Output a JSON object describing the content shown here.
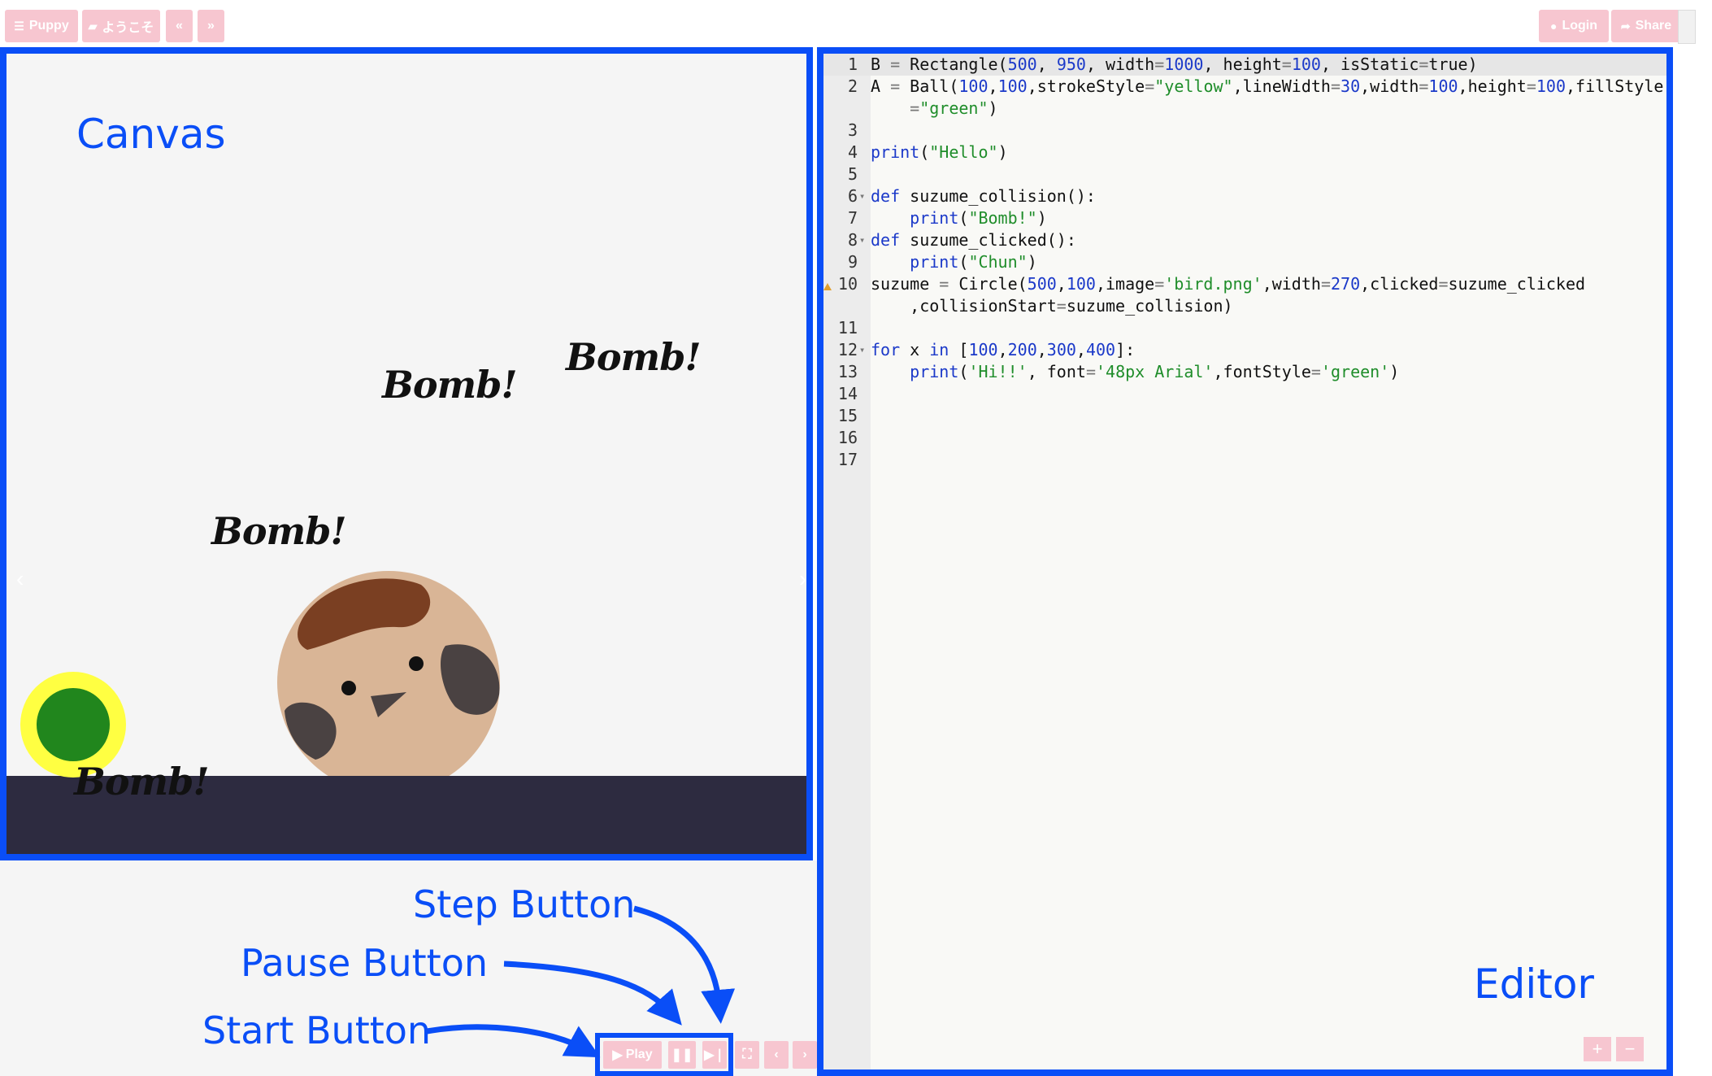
{
  "topbar": {
    "puppy": "Puppy",
    "welcome": "ようこそ",
    "prev": "«",
    "next": "»",
    "login": "Login",
    "share": "Share"
  },
  "canvas": {
    "caption": "Canvas",
    "bombs": [
      "Bomb!",
      "Bomb!",
      "Bomb!",
      "Bomb!"
    ],
    "ground_color": "#2d2b40",
    "ball_fill": "#21861d",
    "ball_stroke": "#ffff42",
    "nav_left": "‹",
    "nav_right": "›"
  },
  "annotations": {
    "step": "Step Button",
    "pause": "Pause Button",
    "start": "Start Button"
  },
  "controls": {
    "play": "Play",
    "pause_icon": "pause-icon",
    "step_icon": "step-icon",
    "fullscreen": "⛶",
    "left": "‹",
    "right": "›"
  },
  "editor": {
    "caption": "Editor",
    "zoom_in": "+",
    "zoom_out": "−",
    "lines": [
      {
        "n": "1",
        "text": "B = Rectangle(500, 950, width=1000, height=100, isStatic=true)"
      },
      {
        "n": "2",
        "text": "A = Ball(100,100,strokeStyle=\"yellow\",lineWidth=30,width=100,height=100,fillStyle"
      },
      {
        "n": "",
        "text": "    =\"green\")"
      },
      {
        "n": "3",
        "text": ""
      },
      {
        "n": "4",
        "text": "print(\"Hello\")"
      },
      {
        "n": "5",
        "text": ""
      },
      {
        "n": "6",
        "text": "def suzume_collision():"
      },
      {
        "n": "7",
        "text": "    print(\"Bomb!\")"
      },
      {
        "n": "8",
        "text": "def suzume_clicked():"
      },
      {
        "n": "9",
        "text": "    print(\"Chun\")"
      },
      {
        "n": "10",
        "text": "suzume = Circle(500,100,image='bird.png',width=270,clicked=suzume_clicked"
      },
      {
        "n": "",
        "text": "    ,collisionStart=suzume_collision)"
      },
      {
        "n": "11",
        "text": ""
      },
      {
        "n": "12",
        "text": "for x in [100,200,300,400]:"
      },
      {
        "n": "13",
        "text": "    print('Hi!!', font='48px Arial',fontStyle='green')"
      },
      {
        "n": "14",
        "text": ""
      },
      {
        "n": "15",
        "text": ""
      },
      {
        "n": "16",
        "text": ""
      },
      {
        "n": "17",
        "text": ""
      }
    ]
  }
}
